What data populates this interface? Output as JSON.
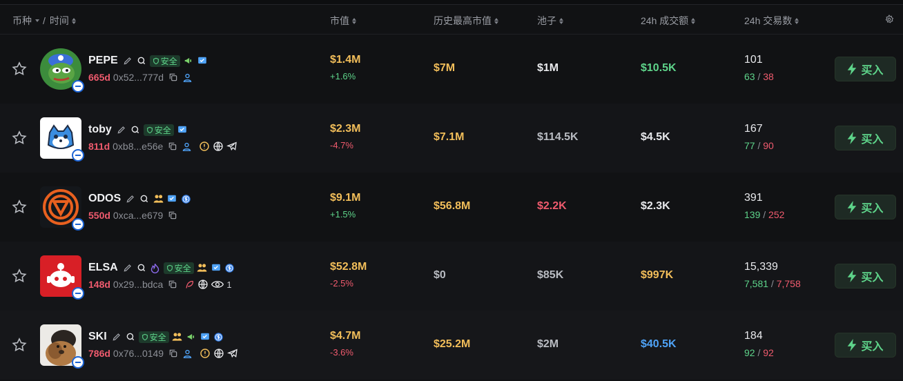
{
  "header": {
    "col_token": "币种",
    "col_sep": "/",
    "col_time": "时间",
    "col_mcap": "市值",
    "col_ath": "历史最高市值",
    "col_pool": "池子",
    "col_vol": "24h 成交额",
    "col_txns": "24h 交易数",
    "settings_icon": "gear-icon"
  },
  "labels": {
    "safe": "安全",
    "buy": "买入"
  },
  "rows": [
    {
      "name": "PEPE",
      "age": "665d",
      "address": "0x52...777d",
      "mcap": "$1.4M",
      "change": "+1.6%",
      "ath": "$7M",
      "pool": "$1M",
      "volume": "$10.5K",
      "txns": "101",
      "buys": "63",
      "sells": "38"
    },
    {
      "name": "toby",
      "age": "811d",
      "address": "0xb8...e56e",
      "mcap": "$2.3M",
      "change": "-4.7%",
      "ath": "$7.1M",
      "pool": "$114.5K",
      "volume": "$4.5K",
      "txns": "167",
      "buys": "77",
      "sells": "90"
    },
    {
      "name": "ODOS",
      "age": "550d",
      "address": "0xca...e679",
      "mcap": "$9.1M",
      "change": "+1.5%",
      "ath": "$56.8M",
      "pool": "$2.2K",
      "volume": "$2.3K",
      "txns": "391",
      "buys": "139",
      "sells": "252"
    },
    {
      "name": "ELSA",
      "age": "148d",
      "address": "0x29...bdca",
      "mcap": "$52.8M",
      "change": "-2.5%",
      "ath": "$0",
      "pool": "$85K",
      "volume": "$997K",
      "txns": "15,339",
      "buys": "7,581",
      "sells": "7,758",
      "views": "1"
    },
    {
      "name": "SKI",
      "age": "786d",
      "address": "0x76...0149",
      "mcap": "$4.7M",
      "change": "-3.6%",
      "ath": "$25.2M",
      "pool": "$2M",
      "volume": "$40.5K",
      "txns": "184",
      "buys": "92",
      "sells": "92"
    }
  ],
  "colors": {
    "gold": "#f2be5a",
    "green": "#5ed48a",
    "red": "#f05b6e",
    "blue": "#4fa3f7",
    "chain_badge": "#1b63d4"
  }
}
